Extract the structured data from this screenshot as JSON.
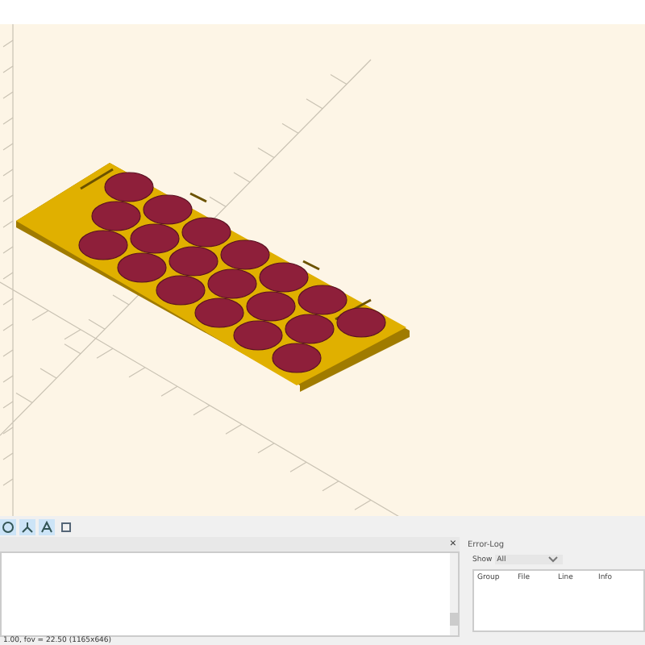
{
  "console": {
    "close": "×"
  },
  "error_log": {
    "title": "Error-Log",
    "show_label": "Show",
    "filter": "All",
    "columns": [
      "Group",
      "File",
      "Line",
      "Info"
    ]
  },
  "status_bar": "1.00, fov = 22.50 (1165x646)"
}
